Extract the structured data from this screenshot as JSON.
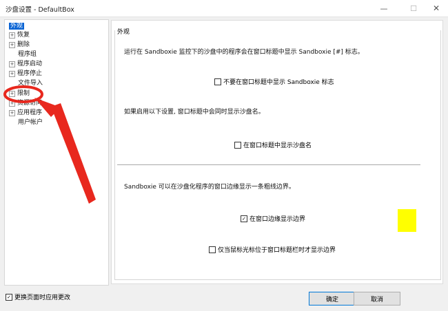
{
  "window": {
    "title": "沙盘设置 - DefaultBox",
    "minimize_glyph": "—",
    "maximize_glyph": "☐",
    "close_glyph": "✕"
  },
  "tree": {
    "items": [
      {
        "label": "外观",
        "expandable": false,
        "selected": true
      },
      {
        "label": "恢复",
        "expandable": true,
        "selected": false
      },
      {
        "label": "删除",
        "expandable": true,
        "selected": false
      },
      {
        "label": "程序组",
        "expandable": false,
        "selected": false
      },
      {
        "label": "程序启动",
        "expandable": true,
        "selected": false
      },
      {
        "label": "程序停止",
        "expandable": true,
        "selected": false
      },
      {
        "label": "文件导入",
        "expandable": false,
        "selected": false
      },
      {
        "label": "限制",
        "expandable": true,
        "selected": false
      },
      {
        "label": "资源访问",
        "expandable": true,
        "selected": false
      },
      {
        "label": "应用程序",
        "expandable": true,
        "selected": false
      },
      {
        "label": "用户帐户",
        "expandable": false,
        "selected": false
      }
    ]
  },
  "panel": {
    "group_title": "外观",
    "desc1": "运行在 Sandboxie 监控下的沙盘中的程序会在窗口标题中显示 Sandboxie [#] 标志。",
    "cb1": {
      "label": "不要在窗口标题中显示 Sandboxie 标志",
      "checked": false
    },
    "desc2": "如果启用以下设置, 窗口标题中会同时显示沙盘名。",
    "cb2": {
      "label": "在窗口标题中显示沙盘名",
      "checked": false
    },
    "desc3": "Sandboxie 可以在沙盘化程序的窗口边缘显示一条粗线边界。",
    "cb3": {
      "label": "在窗口边缘显示边界",
      "checked": true
    },
    "cb4": {
      "label": "仅当鼠标光标位于窗口标题栏时才显示边界",
      "checked": false
    },
    "border_color": "#ffff00"
  },
  "footer": {
    "apply_on_switch": {
      "label": "更换页面时应用更改",
      "checked": true
    },
    "ok_label": "确定",
    "cancel_label": "取消"
  },
  "check_glyph": "✓",
  "expander_glyph": "+",
  "annotation_color": "#e8281e"
}
